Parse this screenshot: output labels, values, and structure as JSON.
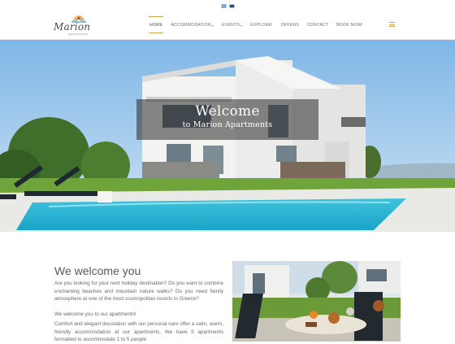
{
  "language_bar": {
    "languages": [
      {
        "code": "gr",
        "icon": "greek-flag-icon"
      },
      {
        "code": "en",
        "icon": "uk-flag-icon"
      }
    ]
  },
  "brand": {
    "logo_text": "Marion",
    "logo_subtext": "apartments"
  },
  "nav": {
    "items": [
      {
        "label": "HOME",
        "active": true
      },
      {
        "label": "ACCOMMODATION",
        "dropdown": true
      },
      {
        "label": "EVENTS",
        "dropdown": true
      },
      {
        "label": "EXPLORE!"
      },
      {
        "label": "OFFERS"
      },
      {
        "label": "CONTACT"
      },
      {
        "label": "BOOK NOW!"
      }
    ],
    "menu_icon": "hamburger-menu-icon"
  },
  "hero": {
    "title": "Welcome",
    "subtitle": "to Marion Apartments"
  },
  "intro": {
    "heading": "We welcome you",
    "paragraphs": [
      "Are you looking for your next holiday destination? Do you want to combine enchanting beaches and mountain nature walks? Do you need family atmosphere at one of the most cosmopolitan resorts in Greece?",
      "We welcome you to our apartments!",
      "Comfort and elegant decoration with our personal care offer a calm, warm, friendly accommodation at our apartments. We have 5 apartments formatted to accommodate 1 to 5 people"
    ]
  },
  "colors": {
    "accent": "#c9a84b",
    "text": "#6a6a6a",
    "overlay": "#282828"
  }
}
